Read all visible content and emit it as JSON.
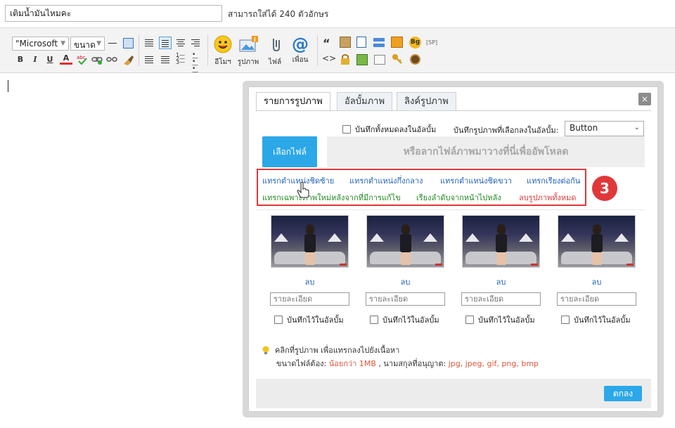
{
  "title_input": {
    "value": "เติมน้ำมันไหมคะ"
  },
  "title_hint": "สามารถใส่ได้ 240 ตัวอักษร",
  "toolbar": {
    "font_select": "\"Microsoft",
    "size_select": "ขนาด",
    "format_buttons": [
      "B",
      "I",
      "U",
      "A"
    ],
    "big_buttons": [
      {
        "label": "อีโมฯ",
        "icon": "emoji-icon"
      },
      {
        "label": "รูปภาพ",
        "icon": "image-icon"
      },
      {
        "label": "ไฟล์",
        "icon": "file-icon"
      },
      {
        "label": "เพื่อน",
        "icon": "at-icon"
      }
    ],
    "quote_glyph": "“",
    "code_glyph": "<>",
    "sp_label": "[SP]",
    "bg_label": "Bg"
  },
  "dialog": {
    "tabs": [
      "รายการรูปภาพ",
      "อัลบั้มภาพ",
      "ลิงค์รูปภาพ"
    ],
    "active_tab": 0,
    "close_glyph": "×",
    "save_all_label": "บันทึกทั้งหมดลงในอัลบั้ม",
    "save_selected_label": "บันทึกรูปภาพที่เลือกลงในอัลบั้ม:",
    "album_select_value": "Button",
    "choose_file_label": "เลือกไฟล์",
    "drop_zone_label": "หรือลากไฟล์ภาพมาวางที่นี่เพื่ออัพโหลด",
    "actions_row1": [
      "แทรกตำแหน่งชิดซ้าย",
      "แทรกตำแหน่งกึ่งกลาง",
      "แทรกตำแหน่งชิดขวา",
      "แทรกเรียงต่อกัน"
    ],
    "actions_row2": [
      "แทรกเฉพาะภาพใหม่หลังจากที่มีการแก้ไข",
      "เรียงลำดับจากหน้าไปหลัง",
      "ลบรูปภาพทั้งหมด"
    ],
    "step_badge": "3",
    "images": [
      {
        "delete_label": "ลบ",
        "caption_placeholder": "รายละเอียด",
        "save_label": "บันทึกไว้ในอัลบั้ม"
      },
      {
        "delete_label": "ลบ",
        "caption_placeholder": "รายละเอียด",
        "save_label": "บันทึกไว้ในอัลบั้ม"
      },
      {
        "delete_label": "ลบ",
        "caption_placeholder": "รายละเอียด",
        "save_label": "บันทึกไว้ในอัลบั้ม"
      },
      {
        "delete_label": "ลบ",
        "caption_placeholder": "รายละเอียด",
        "save_label": "บันทึกไว้ในอัลบั้ม"
      }
    ],
    "hint_text": "คลิกที่รูปภาพ เพื่อแทรกลงไปยังเนื้อหา",
    "size_prefix": "ขนาดไฟล์ต้อง:",
    "size_value": "น้อยกว่า 1MB",
    "types_prefix": ", นามสกุลที่อนุญาต:",
    "types_value": "jpg, jpeg, gif, png, bmp",
    "ok_label": "ตกลง"
  },
  "colors": {
    "accent": "#2ca8e8",
    "highlight": "#e0383a",
    "link": "#2263b8",
    "green": "#228b22"
  }
}
